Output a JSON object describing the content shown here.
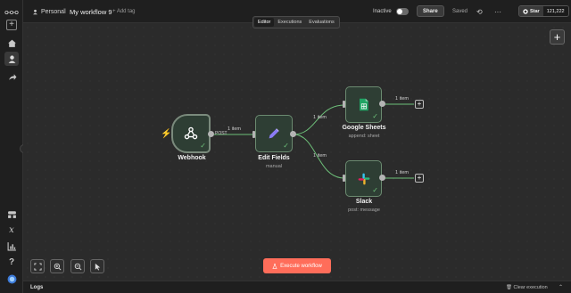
{
  "topbar": {
    "project": "Personal",
    "separator": "/",
    "workflow_name": "My workflow 9",
    "add_tag": "+ Add tag",
    "active_status": "Inactive",
    "share_label": "Share",
    "saved_label": "Saved",
    "star_label": "Star",
    "star_count": "121,222"
  },
  "tabs": [
    {
      "label": "Editor",
      "active": true
    },
    {
      "label": "Executions",
      "active": false
    },
    {
      "label": "Evaluations",
      "active": false
    }
  ],
  "nodes": {
    "webhook": {
      "label": "Webhook",
      "method": "POST"
    },
    "edit_fields": {
      "label": "Edit Fields",
      "subtitle": "manual"
    },
    "google_sheets": {
      "label": "Google Sheets",
      "subtitle": "append: sheet"
    },
    "slack": {
      "label": "Slack",
      "subtitle": "post: message"
    }
  },
  "connections": {
    "webhook_to_edit": "1 item",
    "edit_to_sheets": "1 item",
    "edit_to_slack": "1 item",
    "sheets_out": "1 item",
    "slack_out": "1 item"
  },
  "execute_label": "Execute workflow",
  "logs": {
    "title": "Logs",
    "clear_label": "Clear execution"
  },
  "colors": {
    "accent": "#ff6d5a",
    "node_bg": "#2e3e34",
    "node_border": "#6b8a70",
    "success": "#6ec07a",
    "wire": "#6ec07a"
  },
  "icons": {
    "sidebar": [
      "logo-icon",
      "plus-icon",
      "home-icon",
      "user-icon",
      "share-icon",
      "templates-icon",
      "variables-icon",
      "insights-icon",
      "help-icon",
      "avatar-icon"
    ],
    "controls": [
      "fit-view-icon",
      "zoom-in-icon",
      "zoom-out-icon",
      "pointer-icon"
    ]
  }
}
